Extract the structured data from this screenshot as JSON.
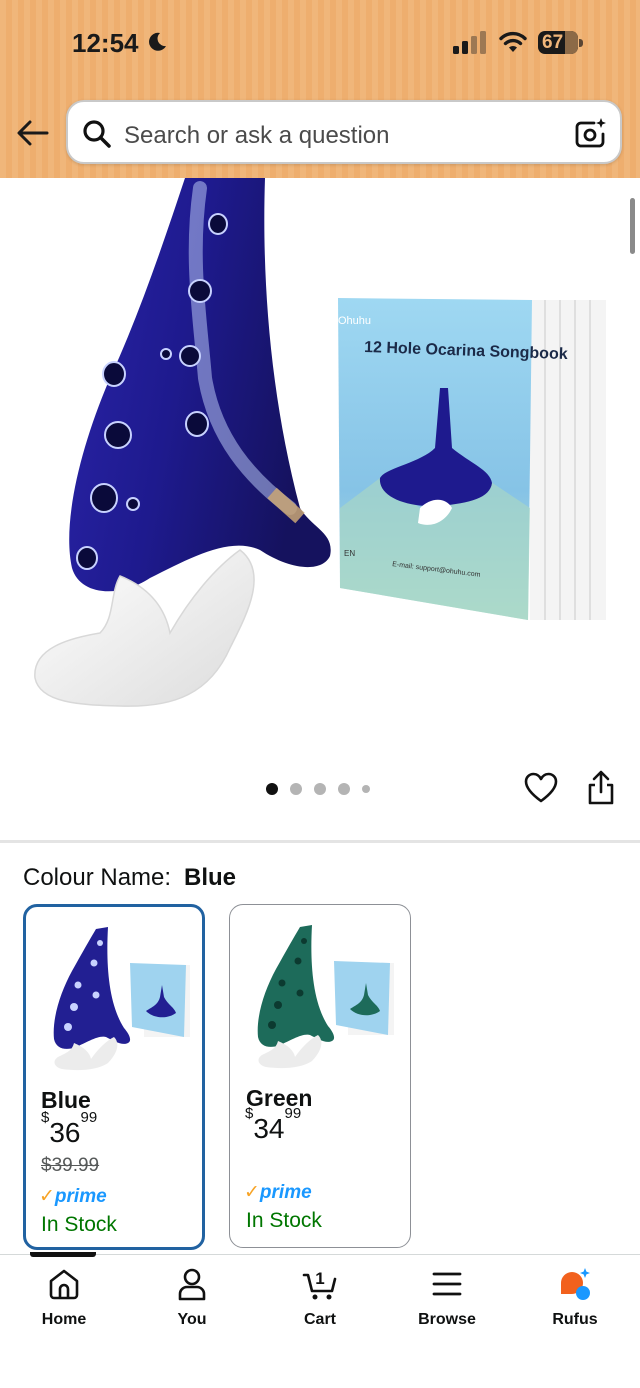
{
  "status_bar": {
    "time": "12:54",
    "battery": "67"
  },
  "search": {
    "placeholder": "Search or ask a question"
  },
  "product_image": {
    "book_title": "12 Hole Ocarina Songbook",
    "book_brand": "Ohuhu",
    "book_lang": "EN",
    "book_email": "E-mail: support@ohuhu.com",
    "carousel_total": 5,
    "carousel_active": 1
  },
  "variation": {
    "label": "Colour Name:",
    "selected": "Blue"
  },
  "swatches": [
    {
      "name": "Blue",
      "price_symbol": "$",
      "price_whole": "36",
      "price_fraction": "99",
      "old_price": "$39.99",
      "prime_check": "✓",
      "prime": "prime",
      "stock": "In Stock",
      "color": "#1f1d8c"
    },
    {
      "name": "Green",
      "price_symbol": "$",
      "price_whole": "34",
      "price_fraction": "99",
      "prime_check": "✓",
      "prime": "prime",
      "stock": "In Stock",
      "color": "#1d6b5a"
    }
  ],
  "bottom_nav": {
    "items": [
      {
        "label": "Home",
        "icon": "home-icon"
      },
      {
        "label": "You",
        "icon": "user-icon"
      },
      {
        "label": "Cart",
        "icon": "cart-icon",
        "badge": "1"
      },
      {
        "label": "Browse",
        "icon": "menu-icon"
      },
      {
        "label": "Rufus",
        "icon": "rufus-icon"
      }
    ]
  },
  "colors": {
    "header": "#f0b67a",
    "selected_border": "#2162a1",
    "prime_blue": "#1a98ff",
    "prime_check": "#f7a325",
    "in_stock": "#007600"
  }
}
